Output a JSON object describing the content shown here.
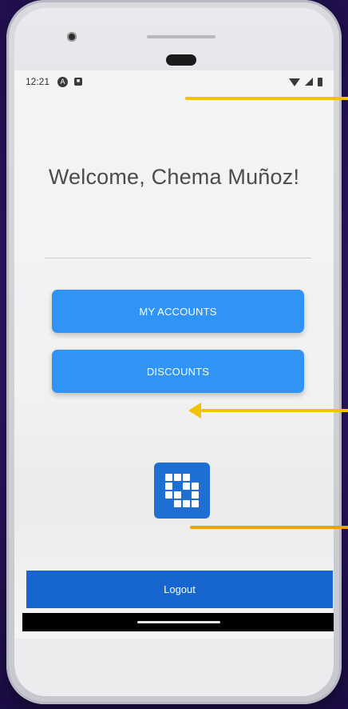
{
  "status_bar": {
    "time": "12:21",
    "left_icons": [
      "app-a-icon",
      "app-b-icon"
    ],
    "right_icons": [
      "wifi-icon",
      "signal-icon",
      "battery-icon"
    ]
  },
  "welcome": {
    "text": "Welcome, Chema Muñoz!"
  },
  "buttons": {
    "accounts": "MY ACCOUNTS",
    "discounts": "DISCOUNTS",
    "logout": "Logout"
  },
  "colors": {
    "primary_button": "#2f94f4",
    "logout_bar": "#1766cf",
    "logo_bg": "#1f6fd3",
    "arrow_yellow": "#f2c200",
    "arrow_orange": "#f0a000",
    "background_purple": "#2a1460"
  },
  "logo": {
    "icon": "brand-logo-icon"
  }
}
